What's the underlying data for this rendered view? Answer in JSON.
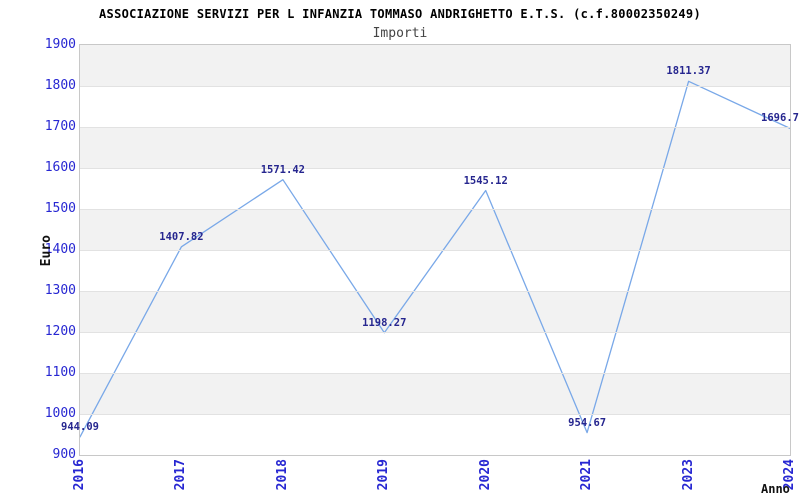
{
  "chart_data": {
    "type": "line",
    "title": "ASSOCIAZIONE SERVIZI PER L INFANZIA TOMMASO ANDRIGHETTO E.T.S. (c.f.80002350249)",
    "subtitle": "Importi",
    "xlabel": "Anno",
    "ylabel": "Euro",
    "categories": [
      "2016",
      "2017",
      "2018",
      "2019",
      "2020",
      "2021",
      "2023",
      "2024"
    ],
    "series": [
      {
        "name": "Importi",
        "values": [
          944.09,
          1407.82,
          1571.42,
          1198.27,
          1545.12,
          954.67,
          1811.37,
          1696.7
        ]
      }
    ],
    "point_labels": [
      "944.09",
      "1407.82",
      "1571.42",
      "1198.27",
      "1545.12",
      "954.67",
      "1811.37",
      "1696.7"
    ],
    "ylim": [
      900,
      1900
    ],
    "y_tick_step": 100,
    "grid": "horizontal",
    "alternating_bands": true,
    "legend": "none",
    "colors": {
      "line": "#79a8e8",
      "tick_label": "#2727d2",
      "point_label": "#26268f",
      "band": "#f2f2f2",
      "gridline": "#e2e2e2",
      "plot_border": "#c8c8c8",
      "title": "#000000",
      "subtitle": "#444444",
      "axis_title": "#111111"
    }
  }
}
